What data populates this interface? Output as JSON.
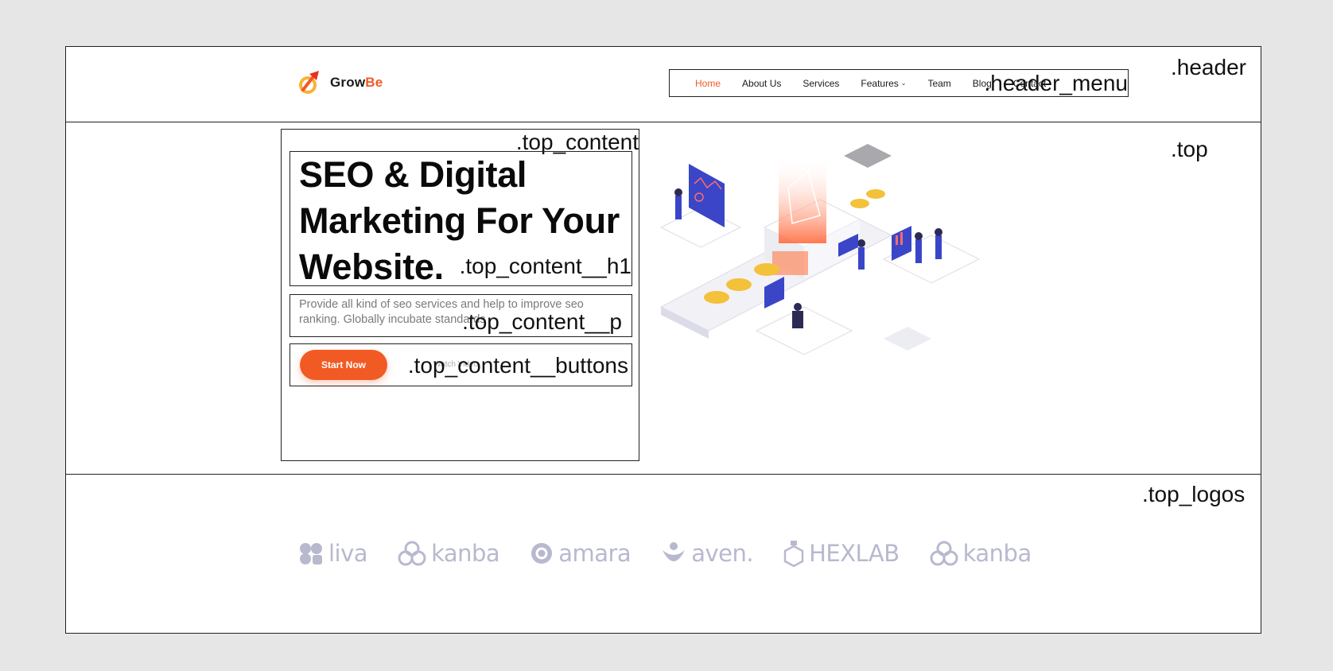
{
  "header": {
    "tag": ".header",
    "brand": {
      "name_main": "Grow",
      "name_accent": "Be",
      "icon": "rocket-arrow-icon"
    },
    "menu": {
      "tag": ".header_menu",
      "items": [
        {
          "label": "Home",
          "active": true
        },
        {
          "label": "About Us"
        },
        {
          "label": "Services"
        },
        {
          "label": "Features",
          "has_dropdown": true
        },
        {
          "label": "Team"
        },
        {
          "label": "Blog"
        },
        {
          "label": "Contact"
        }
      ]
    }
  },
  "top": {
    "tag": ".top",
    "content": {
      "tag": ".top_content",
      "h1": {
        "tag": ".top_content__h1",
        "line1": "SEO & Digital",
        "line2": "Marketing For Your",
        "line3": "Website."
      },
      "p": {
        "tag": ".top_content__p",
        "text": "Provide all kind of seo services and help to improve seo ranking. Globally incubate standards"
      },
      "buttons": {
        "tag": ".top_content__buttons",
        "primary_label": "Start Now",
        "secondary_label": "Watch Video"
      }
    },
    "illustration": "isometric-seo-dashboard-illustration"
  },
  "logos": {
    "tag": ".top_logos",
    "items": [
      {
        "label": "liva",
        "icon": "liva-logo-icon"
      },
      {
        "label": "kanba",
        "icon": "kanba-logo-icon"
      },
      {
        "label": "amara",
        "icon": "amara-logo-icon"
      },
      {
        "label": "aven.",
        "icon": "aven-logo-icon"
      },
      {
        "label": "HEXLAB",
        "icon": "hexlab-logo-icon"
      },
      {
        "label": "kanba",
        "icon": "kanba-logo-icon"
      }
    ]
  },
  "colors": {
    "accent": "#f25a24",
    "logo_gray": "#b8b9cf",
    "text_dark": "#0a0a0a",
    "text_muted": "#7a7a7a"
  }
}
